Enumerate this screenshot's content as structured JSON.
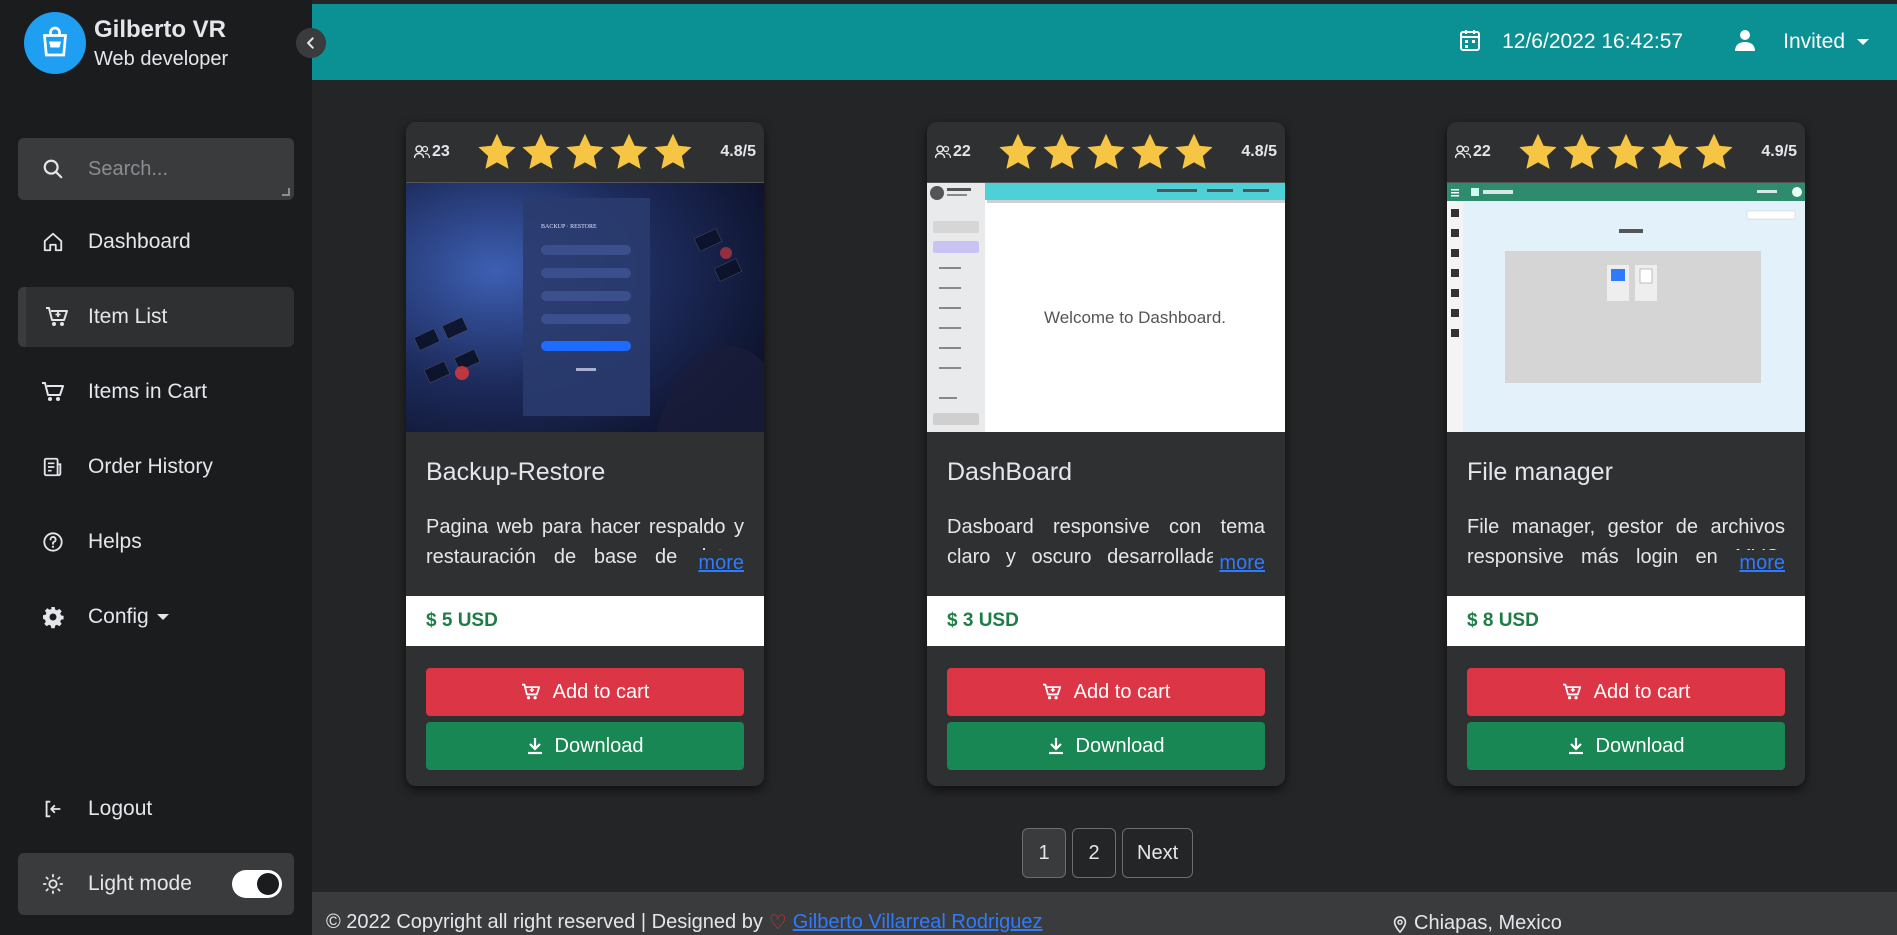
{
  "sidebar": {
    "brand_name": "Gilberto VR",
    "brand_role": "Web developer",
    "search_placeholder": "Search...",
    "items": [
      {
        "label": "Dashboard",
        "icon": "home-icon"
      },
      {
        "label": "Item List",
        "icon": "cart-icon"
      },
      {
        "label": "Items in Cart",
        "icon": "cart-icon"
      },
      {
        "label": "Order History",
        "icon": "receipt-icon"
      },
      {
        "label": "Helps",
        "icon": "question-icon"
      },
      {
        "label": "Config",
        "icon": "gear-icon"
      }
    ],
    "logout_label": "Logout",
    "mode_label": "Light mode"
  },
  "topbar": {
    "datetime": "12/6/2022 16:42:57",
    "user": "Invited"
  },
  "cards": [
    {
      "users": "23",
      "rating": "4.8/5",
      "title": "Backup-Restore",
      "description": "Pagina web para hacer respaldo y restauración de base de datos mysql, desarrollada con php",
      "more": "more",
      "price": "$ 5 USD",
      "add_label": "Add to cart",
      "download_label": "Download"
    },
    {
      "users": "22",
      "rating": "4.8/5",
      "title": "DashBoard",
      "description": "Dasboard responsive con tema claro y oscuro desarrollada con JavaScript, css y html",
      "more": "more",
      "price": "$ 3 USD",
      "add_label": "Add to cart",
      "download_label": "Download",
      "preview_text": "Welcome to Dashboard."
    },
    {
      "users": "22",
      "rating": "4.9/5",
      "title": "File manager",
      "description": "File manager, gestor de archivos responsive más login en MVC, desarrollada con PHP, HTML",
      "more": "more",
      "price": "$ 8 USD",
      "add_label": "Add to cart",
      "download_label": "Download"
    }
  ],
  "pagination": {
    "pages": [
      "1",
      "2"
    ],
    "next": "Next",
    "current": "1"
  },
  "footer": {
    "copyright": "© 2022 Copyright all right reserved | Designed by",
    "author": "Gilberto Villarreal Rodriguez",
    "location": "Chiapas, Mexico"
  },
  "colors": {
    "topbar": "#0b9094",
    "cart_button": "#dc3545",
    "download_button": "#198754",
    "star": "#f6c544",
    "link": "#2f7bff"
  }
}
